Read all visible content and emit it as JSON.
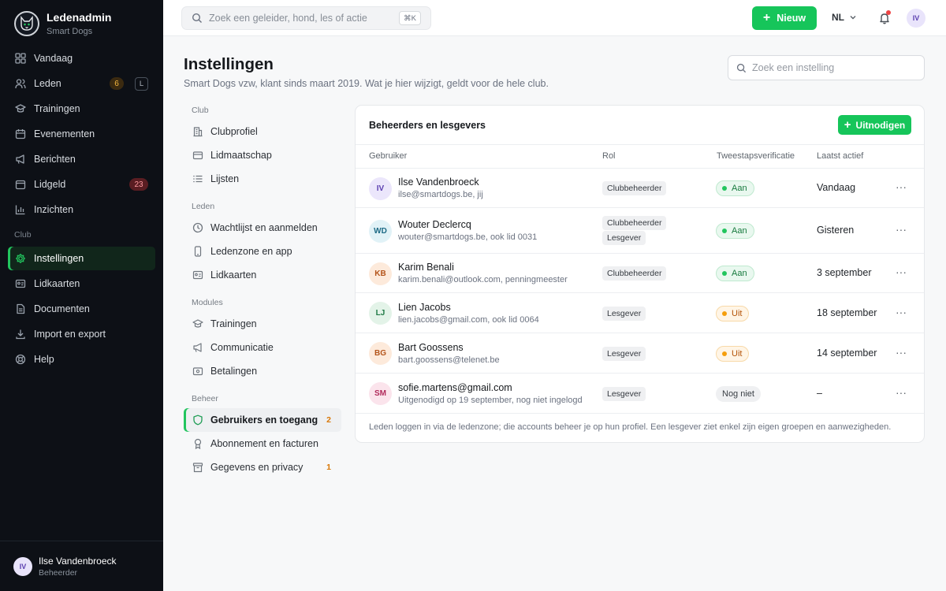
{
  "app": {
    "title": "Ledenadmin",
    "subtitle": "Smart Dogs"
  },
  "sidebar": {
    "items": [
      {
        "label": "Vandaag",
        "icon": "dashboard-grid-icon"
      },
      {
        "label": "Leden",
        "icon": "users-icon",
        "badge": "6",
        "shortcut": "L"
      },
      {
        "label": "Trainingen",
        "icon": "graduation-cap-icon"
      },
      {
        "label": "Evenementen",
        "icon": "calendar-icon"
      },
      {
        "label": "Berichten",
        "icon": "megaphone-icon"
      },
      {
        "label": "Lidgeld",
        "icon": "wallet-icon",
        "badge": "23"
      },
      {
        "label": "Inzichten",
        "icon": "bar-chart-icon"
      }
    ],
    "section_club": "Club",
    "club_items": [
      {
        "label": "Instellingen",
        "icon": "gear-icon",
        "active": true
      },
      {
        "label": "Lidkaarten",
        "icon": "id-card-icon"
      },
      {
        "label": "Documenten",
        "icon": "document-icon"
      },
      {
        "label": "Import en export",
        "icon": "download-icon"
      },
      {
        "label": "Help",
        "icon": "help-lifebuoy-icon"
      }
    ],
    "user": {
      "initials": "IV",
      "name": "Ilse Vandenbroeck",
      "role": "Beheerder"
    }
  },
  "topbar": {
    "search_placeholder": "Zoek een geleider, hond, les of actie",
    "search_shortcut": "⌘K",
    "new_button": "Nieuw",
    "language": "NL",
    "avatar_initials": "IV"
  },
  "page": {
    "title": "Instellingen",
    "subtitle": "Smart Dogs vzw, klant sinds maart 2019. Wat je hier wijzigt, geldt voor de hele club.",
    "search_placeholder": "Zoek een instelling"
  },
  "subnav": {
    "sections": {
      "club": "Club",
      "leden": "Leden",
      "modules": "Modules",
      "beheer": "Beheer"
    },
    "club": [
      {
        "label": "Clubprofiel",
        "icon": "building-icon"
      },
      {
        "label": "Lidmaatschap",
        "icon": "card-icon"
      },
      {
        "label": "Lijsten",
        "icon": "list-icon"
      }
    ],
    "leden": [
      {
        "label": "Wachtlijst en aanmelden",
        "icon": "clock-icon"
      },
      {
        "label": "Ledenzone en app",
        "icon": "phone-icon"
      },
      {
        "label": "Lidkaarten",
        "icon": "id-card-icon"
      }
    ],
    "modules": [
      {
        "label": "Trainingen",
        "icon": "graduation-cap-icon"
      },
      {
        "label": "Communicatie",
        "icon": "megaphone-icon"
      },
      {
        "label": "Betalingen",
        "icon": "payment-icon"
      }
    ],
    "beheer": [
      {
        "label": "Gebruikers en toegang",
        "icon": "shield-icon",
        "badge": "2",
        "active": true
      },
      {
        "label": "Abonnement en facturen",
        "icon": "award-icon"
      },
      {
        "label": "Gegevens en privacy",
        "icon": "archive-icon",
        "badge": "1"
      }
    ]
  },
  "card": {
    "title": "Beheerders en lesgevers",
    "invite_button": "Uitnodigen",
    "columns": [
      "Gebruiker",
      "Rol",
      "Tweestapsverificatie",
      "Laatst actief"
    ],
    "rows": [
      {
        "initials": "IV",
        "name": "Ilse Vandenbroeck",
        "sub": "ilse@smartdogs.be, jij",
        "roles": [
          "Clubbeheerder"
        ],
        "twofa": "Aan",
        "twofa_state": "on",
        "last": "Vandaag",
        "avatar_bg": "#ebe6fb",
        "avatar_fg": "#5b3fb0"
      },
      {
        "initials": "WD",
        "name": "Wouter Declercq",
        "sub": "wouter@smartdogs.be, ook lid 0031",
        "roles": [
          "Clubbeheerder",
          "Lesgever"
        ],
        "twofa": "Aan",
        "twofa_state": "on",
        "last": "Gisteren",
        "avatar_bg": "#e1f2f7",
        "avatar_fg": "#1d6a85"
      },
      {
        "initials": "KB",
        "name": "Karim Benali",
        "sub": "karim.benali@outlook.com, penningmeester",
        "roles": [
          "Clubbeheerder"
        ],
        "twofa": "Aan",
        "twofa_state": "on",
        "last": "3 september",
        "avatar_bg": "#fdeadb",
        "avatar_fg": "#b4541a"
      },
      {
        "initials": "LJ",
        "name": "Lien Jacobs",
        "sub": "lien.jacobs@gmail.com, ook lid 0064",
        "roles": [
          "Lesgever"
        ],
        "twofa": "Uit",
        "twofa_state": "off",
        "last": "18 september",
        "avatar_bg": "#e3f3e8",
        "avatar_fg": "#1f7a45"
      },
      {
        "initials": "BG",
        "name": "Bart Goossens",
        "sub": "bart.goossens@telenet.be",
        "roles": [
          "Lesgever"
        ],
        "twofa": "Uit",
        "twofa_state": "off",
        "last": "14 september",
        "avatar_bg": "#fdeadb",
        "avatar_fg": "#b4541a"
      },
      {
        "initials": "SM",
        "name": "sofie.martens@gmail.com",
        "sub": "Uitgenodigd op 19 september, nog niet ingelogd",
        "roles": [
          "Lesgever"
        ],
        "twofa": "Nog niet",
        "twofa_state": "none",
        "last": "–",
        "avatar_bg": "#fbe4ec",
        "avatar_fg": "#b12a5b"
      }
    ],
    "footer": "Leden loggen in via de ledenzone; die accounts beheer je op hun profiel. Een lesgever ziet enkel zijn eigen groepen en aanwezigheden."
  },
  "colors": {
    "accent": "#16c55a",
    "sidebar_bg": "#0d1016",
    "warning": "#d97706"
  }
}
